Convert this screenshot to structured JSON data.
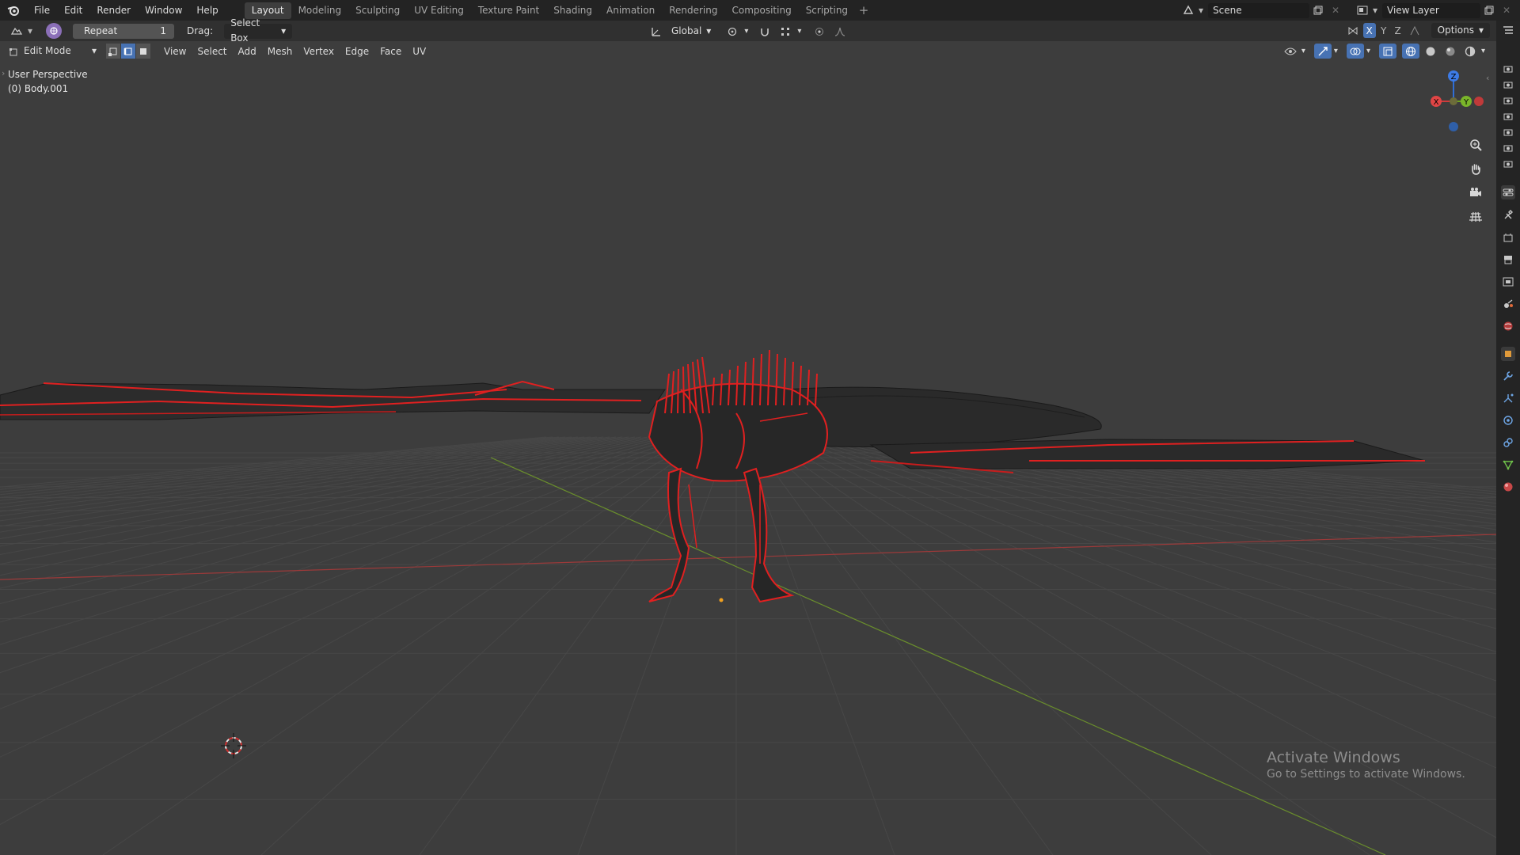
{
  "topbar": {
    "menus": [
      "File",
      "Edit",
      "Render",
      "Window",
      "Help"
    ],
    "workspaces": [
      "Layout",
      "Modeling",
      "Sculpting",
      "UV Editing",
      "Texture Paint",
      "Shading",
      "Animation",
      "Rendering",
      "Compositing",
      "Scripting"
    ],
    "active_workspace": "Layout",
    "add_workspace": "+",
    "scene_name": "Scene",
    "view_layer_name": "View Layer"
  },
  "tool_header": {
    "redo_label": "Repeat",
    "redo_count": "1",
    "drag_label": "Drag:",
    "drag_value": "Select Box",
    "transform_orientation": "Global",
    "axis_labels": [
      "X",
      "Y",
      "Z"
    ],
    "options_label": "Options"
  },
  "viewport_header": {
    "mode": "Edit Mode",
    "menus": [
      "View",
      "Select",
      "Add",
      "Mesh",
      "Vertex",
      "Edge",
      "Face",
      "UV"
    ]
  },
  "viewport": {
    "perspective_label": "User Perspective",
    "object_label": "(0) Body.001",
    "gizmo_axes": {
      "x": "X",
      "y": "Y",
      "z": "Z"
    },
    "colors": {
      "background": "#3d3d3d",
      "grid": "#4a4a4a",
      "x_axis": "#9c3a3a",
      "y_axis": "#6a8e2c",
      "wire": "#1a1a1a",
      "selected_edges": "#e02020"
    }
  },
  "watermark": {
    "title": "Activate Windows",
    "subtitle": "Go to Settings to activate Windows."
  },
  "icons": {
    "logo": "blender-logo-icon",
    "zoom": "zoom-icon",
    "pan": "hand-icon",
    "camera": "camera-icon",
    "ortho": "grid-icon"
  }
}
